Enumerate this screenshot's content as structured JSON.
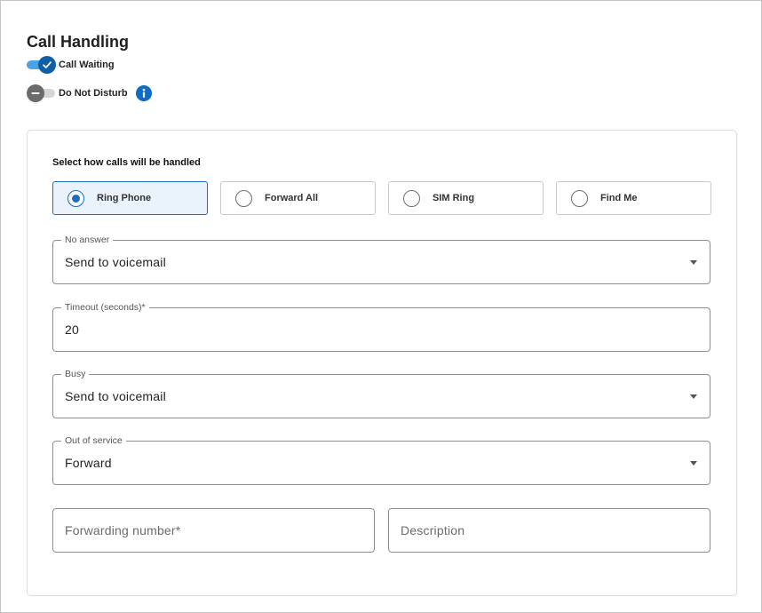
{
  "title": "Call Handling",
  "toggles": {
    "call_waiting": {
      "label": "Call Waiting",
      "on": true
    },
    "do_not_disturb": {
      "label": "Do Not Disturb",
      "on": false
    }
  },
  "handling": {
    "prompt": "Select how calls will be handled",
    "options": [
      {
        "label": "Ring Phone",
        "selected": true
      },
      {
        "label": "Forward All",
        "selected": false
      },
      {
        "label": "SIM Ring",
        "selected": false
      },
      {
        "label": "Find Me",
        "selected": false
      }
    ]
  },
  "fields": {
    "no_answer": {
      "label": "No answer",
      "value": "Send to voicemail"
    },
    "timeout": {
      "label": "Timeout (seconds)*",
      "value": "20"
    },
    "busy": {
      "label": "Busy",
      "value": "Send to voicemail"
    },
    "out_of_service": {
      "label": "Out of service",
      "value": "Forward"
    }
  },
  "forwarding_number": {
    "placeholder": "Forwarding number*"
  },
  "description": {
    "placeholder": "Description"
  },
  "colors": {
    "accent": "#0e5fa6",
    "selected_bg": "#eaf3fc",
    "info_icon": "#0e6cc4"
  }
}
